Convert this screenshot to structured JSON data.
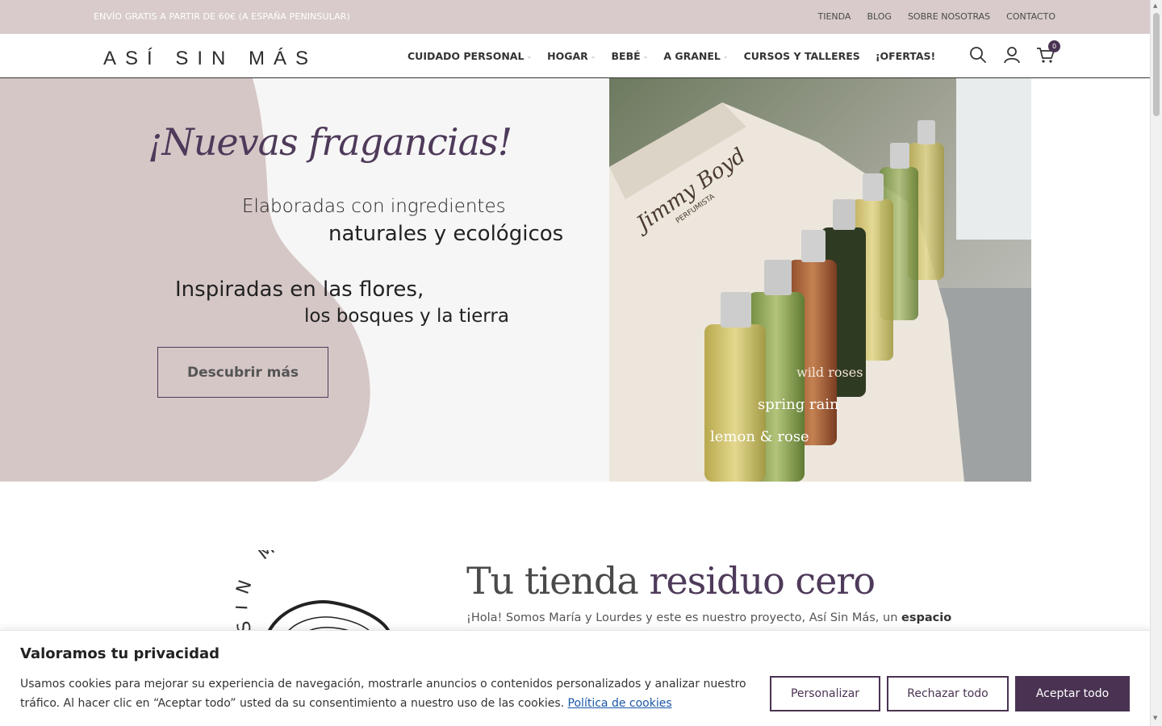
{
  "topbar": {
    "promo": "ENVÍO GRATIS A PARTIR DE 60€ (A ESPAÑA PENINSULAR)",
    "links": [
      "TIENDA",
      "BLOG",
      "SOBRE NOSOTRAS",
      "CONTACTO"
    ]
  },
  "header": {
    "logo": "ASÍ SIN MÁS",
    "nav": [
      {
        "label": "CUIDADO PERSONAL",
        "dropdown": true
      },
      {
        "label": "HOGAR",
        "dropdown": true
      },
      {
        "label": "BEBÉ",
        "dropdown": true
      },
      {
        "label": "A GRANEL",
        "dropdown": true
      },
      {
        "label": "CURSOS Y TALLERES",
        "dropdown": false
      },
      {
        "label": "¡OFERTAS!",
        "dropdown": false
      }
    ],
    "cart_count": "0",
    "icons": [
      "search-icon",
      "user-icon",
      "cart-icon"
    ]
  },
  "hero": {
    "title": "¡Nuevas fragancias!",
    "line1": "Elaboradas con ingredientes",
    "line2": "naturales y ecológicos",
    "line3": "Inspiradas en las flores,",
    "line4": "los bosques y la tierra",
    "button": "Descubrir más",
    "photo_text": {
      "brand": "Jimmy Boyd",
      "sub": "PERFUMISTA",
      "bottle1": "lemon & rose",
      "bottle2": "spring rain",
      "bottle3": "wild roses"
    }
  },
  "section": {
    "badge_text": "SIN MÁS",
    "title_plain": "Tu tienda ",
    "title_accent": "residuo cero",
    "text_plain": "¡Hola! Somos María y Lourdes y este es nuestro proyecto, Así Sin Más, un ",
    "text_bold": "espacio"
  },
  "cookie": {
    "title": "Valoramos tu privacidad",
    "text": "Usamos cookies para mejorar su experiencia de navegación, mostrarle anuncios o contenidos personalizados y analizar nuestro tráfico. Al hacer clic en “Aceptar todo” usted da su consentimiento a nuestro uso de las cookies. ",
    "link": "Política de cookies",
    "btn_customize": "Personalizar",
    "btn_reject": "Rechazar todo",
    "btn_accept": "Aceptar todo"
  },
  "colors": {
    "brand": "#4e3a5a",
    "topbar": "#d9cbcb",
    "blob": "#d6c7c7",
    "button_dark": "#4a3352"
  }
}
